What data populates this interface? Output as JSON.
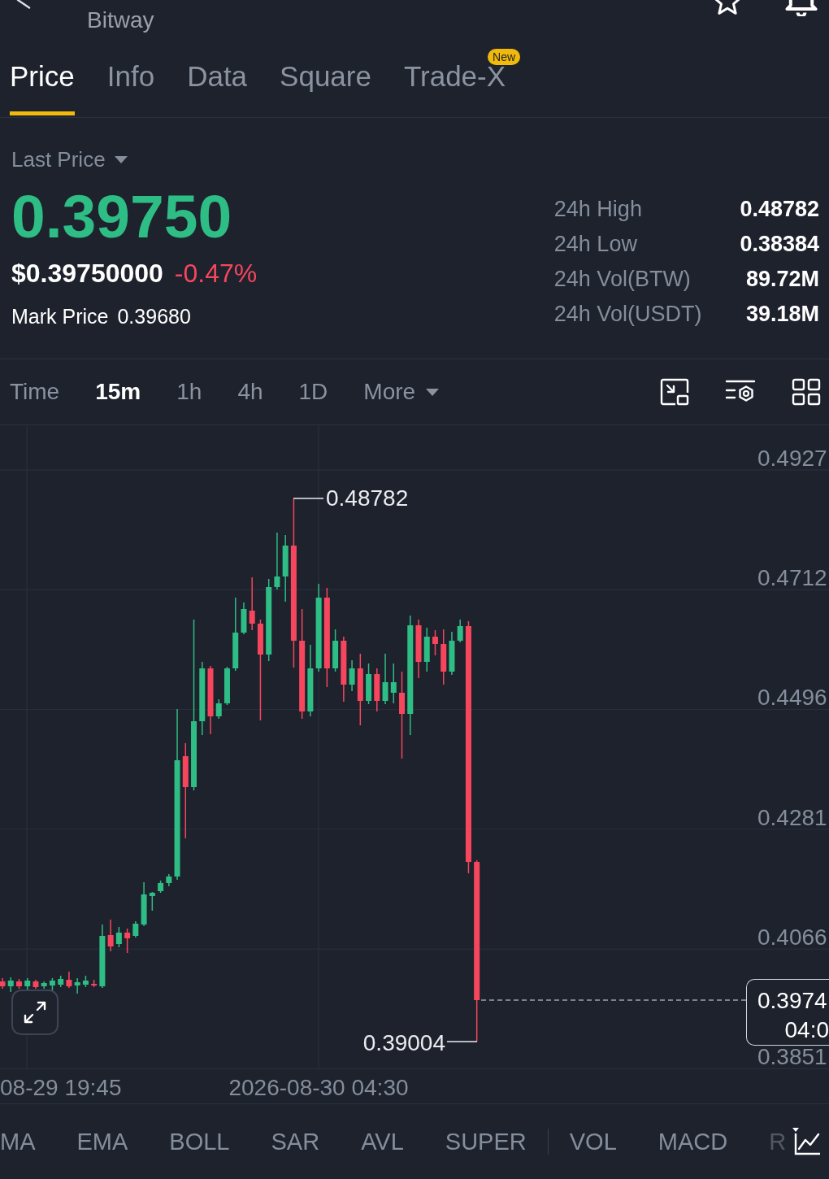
{
  "header": {
    "subtitle": "Bitway"
  },
  "tabs": [
    {
      "label": "Price",
      "selected": true
    },
    {
      "label": "Info",
      "selected": false
    },
    {
      "label": "Data",
      "selected": false
    },
    {
      "label": "Square",
      "selected": false
    },
    {
      "label": "Trade-X",
      "selected": false,
      "badge": "New"
    }
  ],
  "price": {
    "type_selector": "Last Price",
    "last": "0.39750",
    "last_rising": true,
    "usd": "$0.39750000",
    "change": "-0.47%",
    "change_rising": false,
    "mark_label": "Mark Price",
    "mark": "0.39680"
  },
  "stats": [
    {
      "label": "24h High",
      "value": "0.48782"
    },
    {
      "label": "24h Low",
      "value": "0.38384"
    },
    {
      "label": "24h Vol(BTW)",
      "value": "89.72M"
    },
    {
      "label": "24h Vol(USDT)",
      "value": "39.18M"
    }
  ],
  "intervals": [
    {
      "label": "Time",
      "kind": "option",
      "selected": false
    },
    {
      "label": "15m",
      "kind": "option",
      "selected": true
    },
    {
      "label": "1h",
      "kind": "option",
      "selected": false
    },
    {
      "label": "4h",
      "kind": "option",
      "selected": false
    },
    {
      "label": "1D",
      "kind": "option",
      "selected": false
    },
    {
      "label": "More",
      "kind": "menu",
      "selected": false
    }
  ],
  "chart": {
    "price_ticks": [
      "0.4927",
      "0.4712",
      "0.4496",
      "0.4281",
      "0.4066",
      "0.3851"
    ],
    "time_ticks": [
      "08-29 19:45",
      "2026-08-30 04:30"
    ],
    "high_marker": "0.48782",
    "low_marker": "0.39004",
    "last_price_tag": {
      "price": "0.3974",
      "countdown": "04:0"
    }
  },
  "indicators": {
    "main": [
      "MA",
      "EMA",
      "BOLL",
      "SAR",
      "AVL",
      "SUPER"
    ],
    "sub": [
      "VOL",
      "MACD",
      "R"
    ]
  }
}
